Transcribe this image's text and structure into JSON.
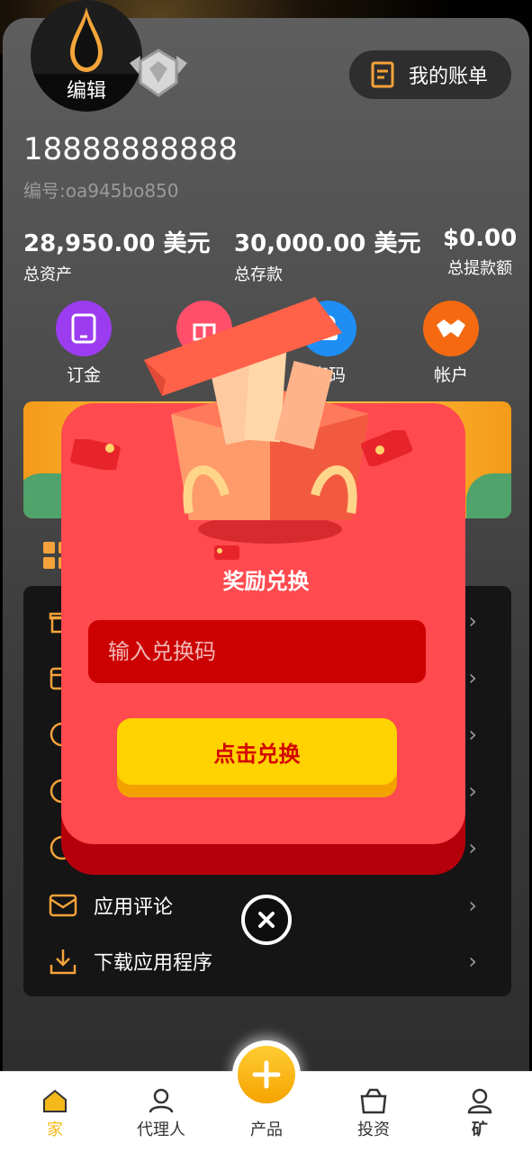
{
  "header": {
    "avatar_edit_label": "编辑",
    "bill_button_label": "我的账单",
    "phone": "18888888888",
    "uid": "编号:oa945bo850"
  },
  "stats": [
    {
      "value": "28,950.00 美元",
      "label": "总资产"
    },
    {
      "value": "30,000.00 美元",
      "label": "总存款"
    },
    {
      "value": "$0.00",
      "label": "总提款额"
    }
  ],
  "quick_actions": [
    {
      "label": "订金",
      "icon": "tablet-icon",
      "color": "#9b3cf0"
    },
    {
      "label": "",
      "icon": "gift-icon",
      "color": "#ff4f6a"
    },
    {
      "label": "密码",
      "icon": "lock-icon",
      "color": "#1e8ef5"
    },
    {
      "label": "帐户",
      "icon": "handshake-icon",
      "color": "#f56a10"
    }
  ],
  "menu": {
    "items": [
      {
        "label": "",
        "icon": "gift-icon"
      },
      {
        "label": "",
        "icon": "calendar-icon"
      },
      {
        "label": "",
        "icon": "chat-icon"
      },
      {
        "label": "",
        "icon": "info-icon"
      },
      {
        "label": "",
        "icon": "info-icon"
      },
      {
        "label": "应用评论",
        "icon": "mail-icon"
      },
      {
        "label": "下载应用程序",
        "icon": "download-icon"
      }
    ]
  },
  "modal": {
    "title": "奖励兑换",
    "input_placeholder": "输入兑换码",
    "redeem_label": "点击兑换"
  },
  "nav": {
    "items": [
      {
        "label": "家",
        "icon": "home-icon",
        "active": true
      },
      {
        "label": "代理人",
        "icon": "user-icon"
      },
      {
        "label": "产品",
        "icon": "plus-icon"
      },
      {
        "label": "投资",
        "icon": "bag-icon"
      },
      {
        "label": "矿",
        "icon": "profile-icon"
      }
    ]
  },
  "colors": {
    "accent": "#f5b81b",
    "modal": "#ff4a4f",
    "button": "#ffd200"
  }
}
